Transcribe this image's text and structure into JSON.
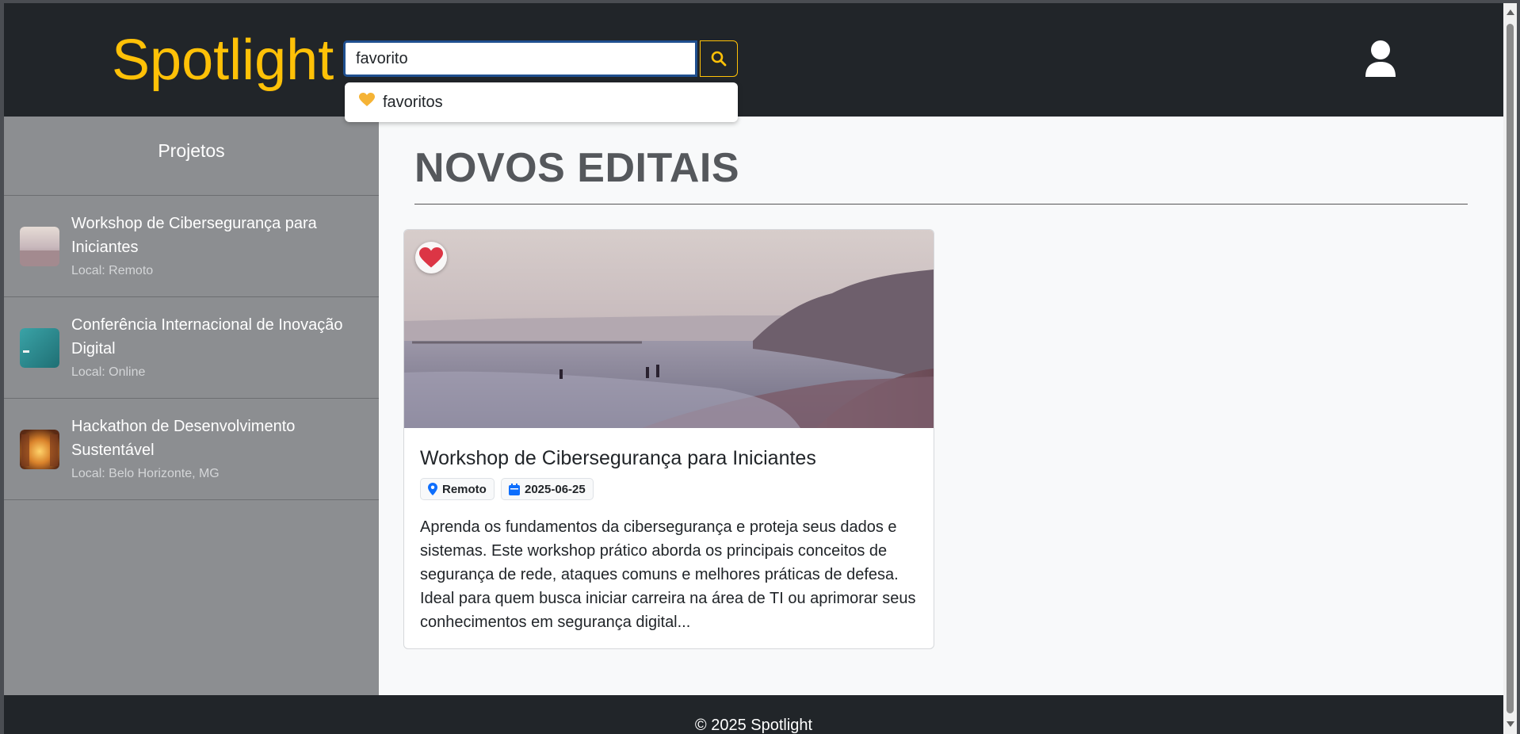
{
  "header": {
    "brand": "Spotlight",
    "search": {
      "value": "favorito",
      "placeholder": ""
    },
    "suggestion": {
      "icon": "yellow-heart-icon",
      "label": "favoritos"
    }
  },
  "sidebar": {
    "title": "Projetos",
    "items": [
      {
        "title": "Workshop de Cibersegurança para Iniciantes",
        "location": "Local: Remoto",
        "thumb": "beach"
      },
      {
        "title": "Conferência Internacional de Inovação Digital",
        "location": "Local: Online",
        "thumb": "ocean"
      },
      {
        "title": "Hackathon de Desenvolvimento Sustentável",
        "location": "Local: Belo Horizonte, MG",
        "thumb": "city-sunset"
      }
    ]
  },
  "main": {
    "title": "NOVOS EDITAIS",
    "cards": [
      {
        "title": "Workshop de Cibersegurança para Iniciantes",
        "location": "Remoto",
        "date": "2025-06-25",
        "description": "Aprenda os fundamentos da cibersegurança e proteja seus dados e sistemas. Este workshop prático aborda os principais conceitos de segurança de rede, ataques comuns e melhores práticas de defesa. Ideal para quem busca iniciar carreira na área de TI ou aprimorar seus conhecimentos em segurança digital...",
        "favorited": true
      }
    ]
  },
  "footer": {
    "text": "© 2025 Spotlight"
  },
  "colors": {
    "accent": "#ffc107",
    "header_bg": "#212529",
    "sidebar_bg": "#8c8e91",
    "favorite": "#dc3545"
  }
}
